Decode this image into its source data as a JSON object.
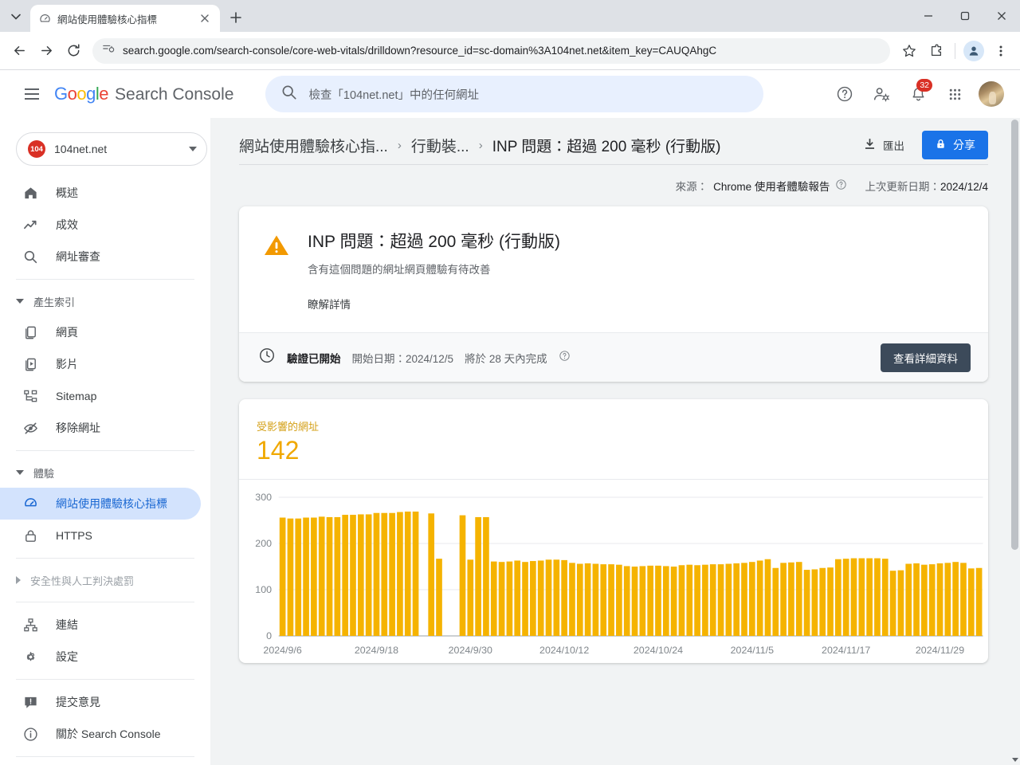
{
  "browser": {
    "tab": {
      "title": "網站使用體驗核心指標",
      "favicon": "speedometer-icon"
    },
    "new_tab_label": "+",
    "url": "search.google.com/search-console/core-web-vitals/drilldown?resource_id=sc-domain%3A104net.net&item_key=CAUQAhgC",
    "window_controls": {
      "minimize": "–",
      "maximize": "□",
      "close": "✕"
    }
  },
  "header": {
    "brand": "Search Console",
    "brand_google": "Google",
    "search_placeholder": "檢查「104net.net」中的任何網址",
    "notifications_count": "32",
    "icons": [
      "help-icon",
      "account-settings-icon",
      "notifications-icon",
      "google-apps-icon",
      "user-avatar"
    ]
  },
  "sidebar": {
    "property": {
      "name": "104net.net",
      "icon_text": "104"
    },
    "items": [
      {
        "label": "概述",
        "icon": "home-icon",
        "active": false
      },
      {
        "label": "成效",
        "icon": "trending-up-icon",
        "active": false
      },
      {
        "label": "網址審查",
        "icon": "search-icon",
        "active": false
      }
    ],
    "group_index": {
      "label": "產生索引",
      "expanded": true
    },
    "index_items": [
      {
        "label": "網頁",
        "icon": "pages-icon",
        "active": false
      },
      {
        "label": "影片",
        "icon": "video-icon",
        "active": false
      },
      {
        "label": "Sitemap",
        "icon": "sitemap-icon",
        "active": false
      },
      {
        "label": "移除網址",
        "icon": "eye-off-icon",
        "active": false
      }
    ],
    "group_experience": {
      "label": "體驗",
      "expanded": true
    },
    "experience_items": [
      {
        "label": "網站使用體驗核心指標",
        "icon": "speedometer-icon",
        "active": true
      },
      {
        "label": "HTTPS",
        "icon": "lock-icon",
        "active": false
      }
    ],
    "group_security": {
      "label": "安全性與人工判決處罰",
      "expanded": false
    },
    "bottom_items": [
      {
        "label": "連結",
        "icon": "links-icon"
      },
      {
        "label": "設定",
        "icon": "gear-icon"
      }
    ],
    "footer_items": [
      {
        "label": "提交意見",
        "icon": "feedback-icon"
      },
      {
        "label": "關於 Search Console",
        "icon": "info-icon"
      }
    ]
  },
  "main": {
    "breadcrumb": [
      {
        "label": "網站使用體驗核心指...",
        "current": false
      },
      {
        "label": "行動裝...",
        "current": false
      },
      {
        "label": "INP 問題：超過 200 毫秒 (行動版)",
        "current": true
      }
    ],
    "breadcrumb_separator": "›",
    "export_label": "匯出",
    "share_label": "分享",
    "meta": {
      "source_label": "來源：",
      "source_value": "Chrome 使用者體驗報告",
      "updated_label": "上次更新日期：",
      "updated_value": "2024/12/4"
    },
    "issue": {
      "title": "INP 問題：超過 200 毫秒 (行動版)",
      "subtitle": "含有這個問題的網址網頁體驗有待改善",
      "learn_more": "瞭解詳情",
      "icon": "warning-icon",
      "icon_color": "#f29900"
    },
    "validation": {
      "icon": "clock-icon",
      "status": "驗證已開始",
      "start_label": "開始日期：2024/12/5",
      "eta_label": "將於 28 天內完成",
      "help_icon": "help-circle-icon",
      "details_button": "查看詳細資料"
    }
  },
  "chart_data": {
    "type": "bar",
    "title": "受影響的網址",
    "value_label": "142",
    "xlabel": "",
    "ylabel": "",
    "ylim": [
      0,
      300
    ],
    "yticks": [
      0,
      100,
      200,
      300
    ],
    "grid": true,
    "bar_color": "#f5b300",
    "tick_labels": [
      "2024/9/6",
      "2024/9/18",
      "2024/9/30",
      "2024/10/12",
      "2024/10/24",
      "2024/11/5",
      "2024/11/17",
      "2024/11/29"
    ],
    "tick_indices": [
      0,
      12,
      24,
      36,
      48,
      60,
      72,
      84
    ],
    "categories": [
      "2024/9/6",
      "2024/9/7",
      "2024/9/8",
      "2024/9/9",
      "2024/9/10",
      "2024/9/11",
      "2024/9/12",
      "2024/9/13",
      "2024/9/14",
      "2024/9/15",
      "2024/9/16",
      "2024/9/17",
      "2024/9/18",
      "2024/9/19",
      "2024/9/20",
      "2024/9/21",
      "2024/9/22",
      "2024/9/23",
      "2024/9/24",
      "2024/9/25",
      "2024/9/26",
      "2024/9/27",
      "2024/9/28",
      "2024/9/29",
      "2024/9/30",
      "2024/10/1",
      "2024/10/2",
      "2024/10/3",
      "2024/10/4",
      "2024/10/5",
      "2024/10/6",
      "2024/10/7",
      "2024/10/8",
      "2024/10/9",
      "2024/10/10",
      "2024/10/11",
      "2024/10/12",
      "2024/10/13",
      "2024/10/14",
      "2024/10/15",
      "2024/10/16",
      "2024/10/17",
      "2024/10/18",
      "2024/10/19",
      "2024/10/20",
      "2024/10/21",
      "2024/10/22",
      "2024/10/23",
      "2024/10/24",
      "2024/10/25",
      "2024/10/26",
      "2024/10/27",
      "2024/10/28",
      "2024/10/29",
      "2024/10/30",
      "2024/10/31",
      "2024/11/1",
      "2024/11/2",
      "2024/11/3",
      "2024/11/4",
      "2024/11/5",
      "2024/11/6",
      "2024/11/7",
      "2024/11/8",
      "2024/11/9",
      "2024/11/10",
      "2024/11/11",
      "2024/11/12",
      "2024/11/13",
      "2024/11/14",
      "2024/11/15",
      "2024/11/16",
      "2024/11/17",
      "2024/11/18",
      "2024/11/19",
      "2024/11/20",
      "2024/11/21",
      "2024/11/22",
      "2024/11/23",
      "2024/11/24",
      "2024/11/25",
      "2024/11/26",
      "2024/11/27",
      "2024/11/28",
      "2024/11/29",
      "2024/11/30",
      "2024/12/1",
      "2024/12/2",
      "2024/12/3",
      "2024/12/4"
    ],
    "values": [
      256,
      254,
      254,
      256,
      256,
      258,
      257,
      257,
      262,
      262,
      263,
      263,
      266,
      266,
      266,
      268,
      269,
      269,
      null,
      265,
      167,
      null,
      null,
      261,
      165,
      257,
      257,
      161,
      160,
      161,
      163,
      160,
      162,
      163,
      165,
      165,
      164,
      158,
      156,
      157,
      156,
      155,
      155,
      154,
      151,
      150,
      151,
      152,
      152,
      151,
      150,
      153,
      154,
      153,
      154,
      155,
      155,
      156,
      157,
      158,
      160,
      163,
      166,
      147,
      158,
      159,
      160,
      143,
      144,
      147,
      148,
      166,
      167,
      168,
      168,
      168,
      168,
      167,
      141,
      142,
      156,
      157,
      154,
      155,
      157,
      158,
      160,
      158,
      146,
      147
    ]
  }
}
